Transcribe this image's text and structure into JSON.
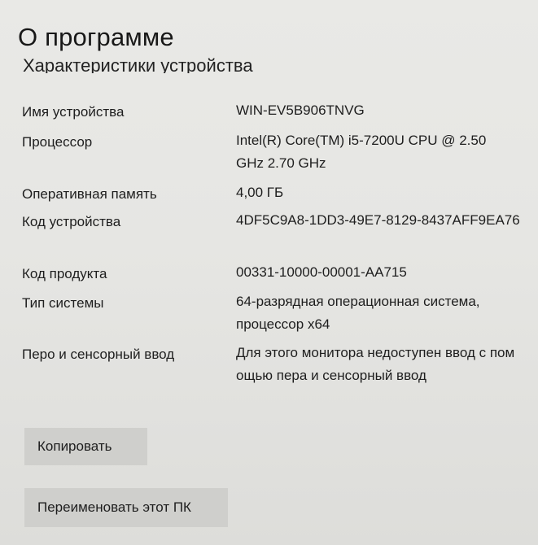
{
  "page": {
    "title": "О программе",
    "section_heading": "Характеристики устройства"
  },
  "specs": [
    {
      "label": "Имя устройства",
      "value": "WIN-EV5B906TNVG"
    },
    {
      "label": "Процессор",
      "value": "Intel(R) Core(TM) i5-7200U CPU @ 2.50GHz 2.70 GHz"
    },
    {
      "label": "Оперативная память",
      "value": "4,00 ГБ"
    },
    {
      "label": "Код устройства",
      "value": "4DF5C9A8-1DD3-49E7-8129-8437AFF9EA76"
    },
    {
      "label": "Код продукта",
      "value": "00331-10000-00001-AA715"
    },
    {
      "label": "Тип системы",
      "value": "64-разрядная операционная система, процессор x64"
    },
    {
      "label": "Перо и сенсорный ввод",
      "value": "Для этого монитора недоступен ввод с помощью пера и сенсорный ввод"
    }
  ],
  "buttons": {
    "copy_label": "Копировать",
    "rename_label": "Переименовать этот ПК"
  }
}
